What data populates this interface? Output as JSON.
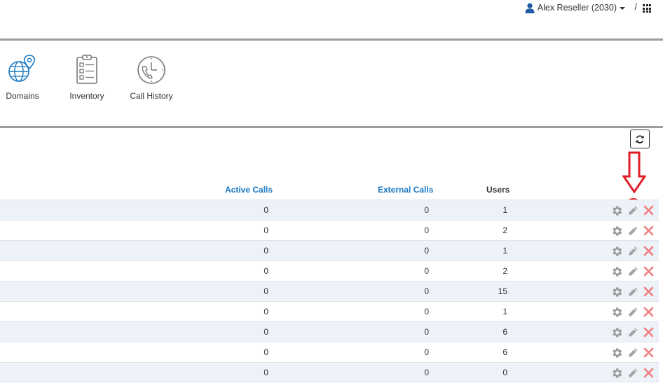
{
  "header": {
    "user_label": "Alex Reseller (2030)",
    "separator": "/"
  },
  "nav": {
    "items": [
      {
        "label": "Domains",
        "icon": "globe-location-icon"
      },
      {
        "label": "Inventory",
        "icon": "clipboard-checklist-icon"
      },
      {
        "label": "Call History",
        "icon": "phone-clock-icon"
      }
    ]
  },
  "table": {
    "columns": {
      "active_calls": "Active Calls",
      "external_calls": "External Calls",
      "users": "Users"
    },
    "rows": [
      {
        "active_calls": "0",
        "external_calls": "0",
        "users": "1"
      },
      {
        "active_calls": "0",
        "external_calls": "0",
        "users": "2"
      },
      {
        "active_calls": "0",
        "external_calls": "0",
        "users": "1"
      },
      {
        "active_calls": "0",
        "external_calls": "0",
        "users": "2"
      },
      {
        "active_calls": "0",
        "external_calls": "0",
        "users": "15"
      },
      {
        "active_calls": "0",
        "external_calls": "0",
        "users": "1"
      },
      {
        "active_calls": "0",
        "external_calls": "0",
        "users": "6"
      },
      {
        "active_calls": "0",
        "external_calls": "0",
        "users": "6"
      },
      {
        "active_calls": "0",
        "external_calls": "0",
        "users": "0"
      }
    ]
  },
  "colors": {
    "link_blue": "#1a78c2",
    "row_stripe": "#edf1f8",
    "delete_red": "#ef7d7d",
    "annotation_red": "#e01e25",
    "divider": "#9c9c9c"
  }
}
